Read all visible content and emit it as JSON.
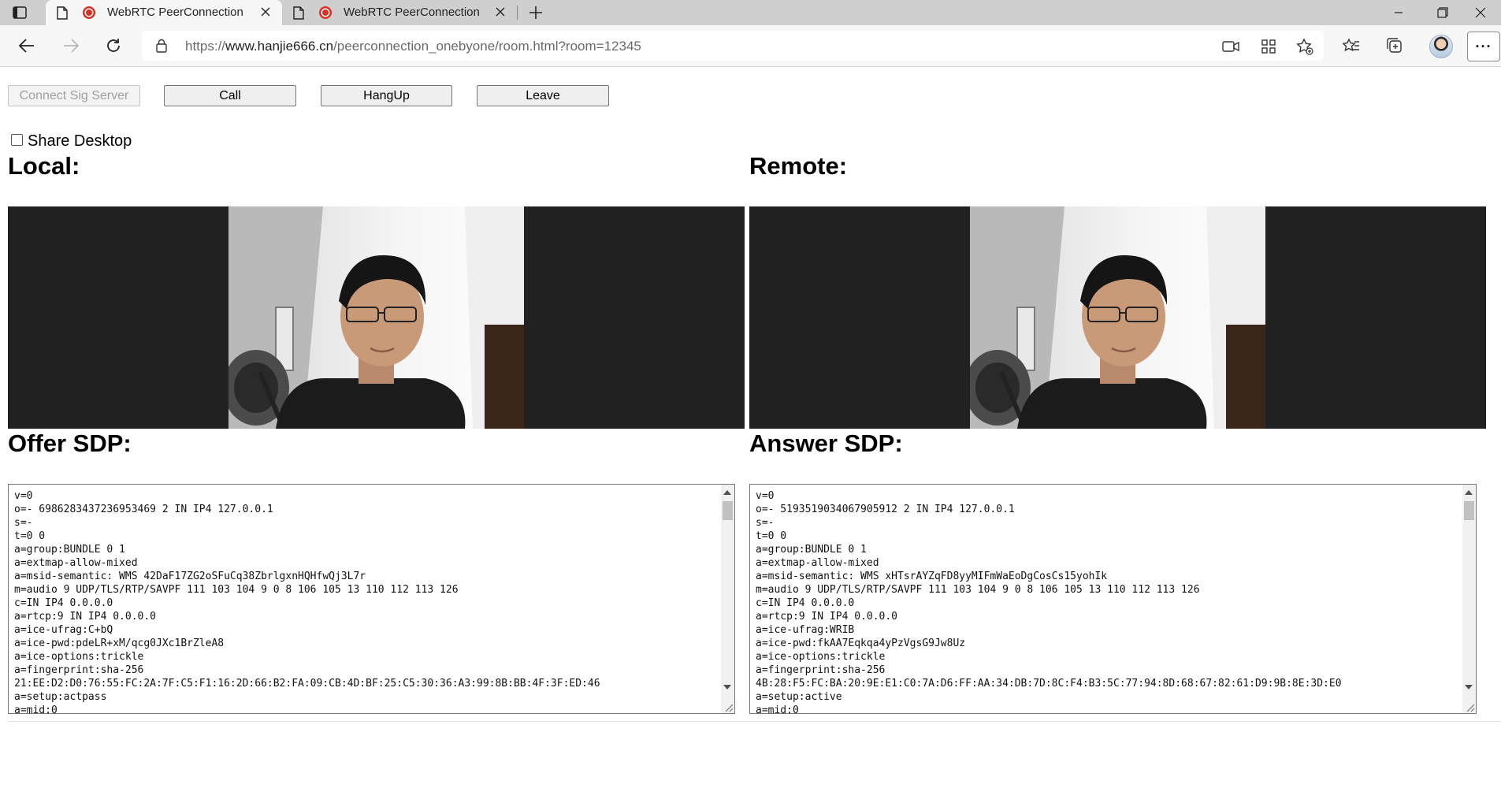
{
  "browser": {
    "tabs": [
      {
        "title": "WebRTC PeerConnection",
        "active": true
      },
      {
        "title": "WebRTC PeerConnection",
        "active": false
      }
    ],
    "url": {
      "scheme": "https://",
      "host": "www.hanjie666.cn",
      "path": "/peerconnection_onebyone/room.html?room=12345"
    }
  },
  "controls": {
    "connect_label": "Connect Sig Server",
    "call_label": "Call",
    "hangup_label": "HangUp",
    "leave_label": "Leave",
    "share_desktop_label": "Share Desktop",
    "share_desktop_checked": false
  },
  "headings": {
    "local": "Local:",
    "remote": "Remote:",
    "offer": "Offer SDP:",
    "answer": "Answer SDP:"
  },
  "offer_sdp": "v=0\no=- 6986283437236953469 2 IN IP4 127.0.0.1\ns=-\nt=0 0\na=group:BUNDLE 0 1\na=extmap-allow-mixed\na=msid-semantic: WMS 42DaF17ZG2oSFuCq38ZbrlgxnHQHfwQj3L7r\nm=audio 9 UDP/TLS/RTP/SAVPF 111 103 104 9 0 8 106 105 13 110 112 113 126\nc=IN IP4 0.0.0.0\na=rtcp:9 IN IP4 0.0.0.0\na=ice-ufrag:C+bQ\na=ice-pwd:pdeLR+xM/qcg0JXc1BrZleA8\na=ice-options:trickle\na=fingerprint:sha-256\n21:EE:D2:D0:76:55:FC:2A:7F:C5:F1:16:2D:66:B2:FA:09:CB:4D:BF:25:C5:30:36:A3:99:8B:BB:4F:3F:ED:46\na=setup:actpass\na=mid:0",
  "answer_sdp": "v=0\no=- 5193519034067905912 2 IN IP4 127.0.0.1\ns=-\nt=0 0\na=group:BUNDLE 0 1\na=extmap-allow-mixed\na=msid-semantic: WMS xHTsrAYZqFD8yyMIFmWaEoDgCosCs15yohIk\nm=audio 9 UDP/TLS/RTP/SAVPF 111 103 104 9 0 8 106 105 13 110 112 113 126\nc=IN IP4 0.0.0.0\na=rtcp:9 IN IP4 0.0.0.0\na=ice-ufrag:WRIB\na=ice-pwd:fkAA7Eqkqa4yPzVgsG9Jw8Uz\na=ice-options:trickle\na=fingerprint:sha-256\n4B:28:F5:FC:BA:20:9E:E1:C0:7A:D6:FF:AA:34:DB:7D:8C:F4:B3:5C:77:94:8D:68:67:82:61:D9:9B:8E:3D:E0\na=setup:active\na=mid:0"
}
